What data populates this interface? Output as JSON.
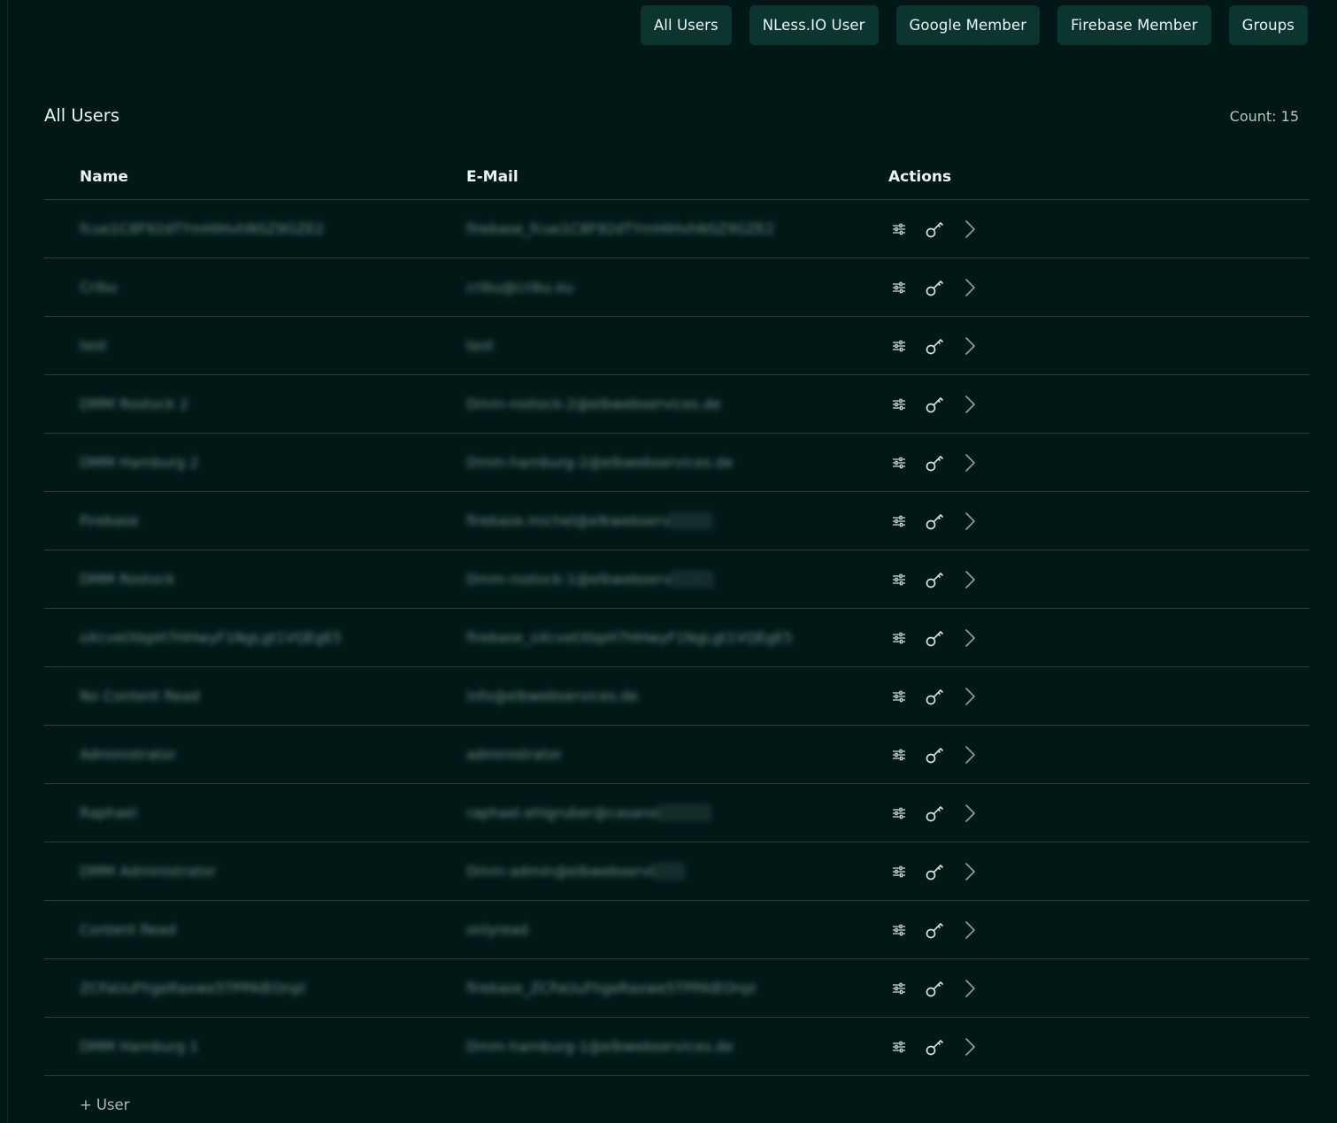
{
  "tabs": [
    "All Users",
    "NLess.IO User",
    "Google Member",
    "Firebase Member",
    "Groups"
  ],
  "section_title": "All Users",
  "count_label": "Count",
  "count_value": "15",
  "columns": {
    "name": "Name",
    "email": "E-Mail",
    "actions": "Actions"
  },
  "rows": [
    {
      "name": "fcue1C8F92dTYmHIHvhNSZ9GZE2",
      "email": "firebase_fcue1C8F92dTYmHIHvhNSZ9GZE2"
    },
    {
      "name": "Cribu",
      "email": "cribu@cribu.eu"
    },
    {
      "name": "test",
      "email": "test"
    },
    {
      "name": "DMM Rostock 2",
      "email": "Dmm-rostock-2@elbwebservices.de"
    },
    {
      "name": "DMM Hamburg 2",
      "email": "Dmm-hamburg-2@elbwebservices.de"
    },
    {
      "name": "Firebase",
      "email": "firebase.michel@elbwebserv░░░░"
    },
    {
      "name": "DMM Rostock",
      "email": "Dmm-rostock-1@elbwebserv░░░░"
    },
    {
      "name": "oXcvetXbpH7HHwyF1NgLgt1VQEgE5",
      "email": "firebase_oXcvetXbpH7HHwyF1NgLgt1VQEgE5"
    },
    {
      "name": "No Content Read",
      "email": "info@elbwebservices.de"
    },
    {
      "name": "Administrator",
      "email": "administrator"
    },
    {
      "name": "Raphael",
      "email": "raphael.ehlgruber@casano░░░░░"
    },
    {
      "name": "DMM Administrator",
      "email": "Dmm-admin@elbwebservi░░░"
    },
    {
      "name": "Content Read",
      "email": "onlyread"
    },
    {
      "name": "ZCFaUuFhgeRaxwe5TPPAIEOnpl",
      "email": "firebase_ZCFaUuFhgeRaxwe5TPPAIEOnpl"
    },
    {
      "name": "DMM Hamburg 1",
      "email": "Dmm-hamburg-1@elbwebservices.de"
    }
  ],
  "icons": {
    "settings": "sliders-icon",
    "key": "key-icon",
    "open": "chevron-right-icon"
  },
  "add_user_plus": "+",
  "add_user_label": "User"
}
